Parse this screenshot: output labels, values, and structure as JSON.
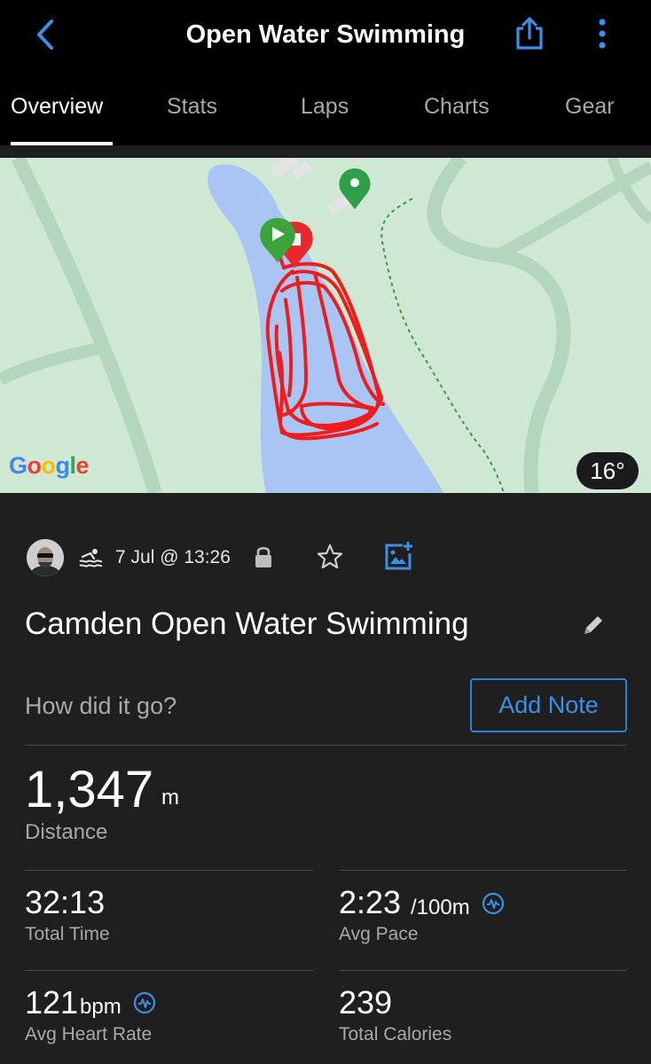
{
  "header": {
    "title": "Open Water Swimming",
    "back_icon": "chevron-left-icon",
    "share_icon": "share-icon",
    "more_icon": "more-vertical-icon"
  },
  "tabs": [
    {
      "label": "Overview",
      "active": true
    },
    {
      "label": "Stats",
      "active": false
    },
    {
      "label": "Laps",
      "active": false
    },
    {
      "label": "Charts",
      "active": false
    },
    {
      "label": "Gear",
      "active": false
    }
  ],
  "map": {
    "provider_logo": "Google",
    "temperature": "16°",
    "start_marker_icon": "play-icon",
    "end_marker_icon": "stop-icon",
    "poi_marker_icon": "location-pin-icon"
  },
  "activity": {
    "date": "7 Jul @ 13:26",
    "type_icon": "swimming-icon",
    "privacy_icon": "lock-icon",
    "favorite_icon": "star-icon",
    "add_photo_icon": "add-photo-icon",
    "name": "Camden Open Water Swimming",
    "edit_icon": "pencil-icon"
  },
  "note": {
    "prompt": "How did it go?",
    "button_label": "Add Note"
  },
  "stats": {
    "distance": {
      "value": "1,347",
      "unit": "m",
      "label": "Distance"
    },
    "total_time": {
      "value": "32:13",
      "label": "Total Time"
    },
    "avg_pace": {
      "value": "2:23",
      "unit": "/100m",
      "label": "Avg Pace"
    },
    "avg_heart_rate": {
      "value": "121",
      "unit": "bpm",
      "label": "Avg Heart Rate"
    },
    "total_calories": {
      "value": "239",
      "label": "Total Calories"
    }
  },
  "colors": {
    "accent_blue": "#2f7fd8",
    "route_red": "#ee1c1c",
    "start_green": "#3aa43a",
    "water_blue": "#a8c5f3",
    "land_green": "#cfe8d3"
  }
}
